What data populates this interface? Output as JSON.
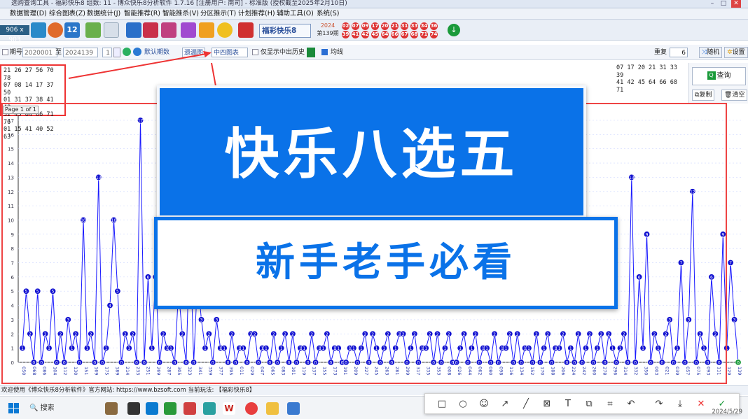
{
  "window": {
    "title": "选购查询工具 - 福彩快乐8 组数: 11 - 博众快乐8分析软件 1.7.16 [注册用户: 南司] - 标准版 (授权截至2025年2月10日)"
  },
  "menu": [
    "数据管理(D)",
    "综合图表(Z)",
    "数据统计(J)",
    "智能推荐(R)",
    "智能推杀(V)",
    "分区推示(T)",
    "计划推荐(H)",
    "辅助工具(O)",
    "系统(S)"
  ],
  "toolbar": {
    "resolution": "906 x 903",
    "lottery": "福彩快乐8",
    "issue_year": "2024",
    "issue_no": "第139期",
    "draw_top": [
      "02",
      "07",
      "09",
      "17",
      "20",
      "21",
      "31",
      "33",
      "34",
      "36"
    ],
    "draw_bottom": [
      "39",
      "41",
      "42",
      "45",
      "64",
      "66",
      "67",
      "68",
      "71",
      "74"
    ]
  },
  "filter": {
    "issue_label": "期号",
    "from": "2020001",
    "to_label": "至",
    "to": "2024139",
    "step": "1",
    "default_issue": "默认期数",
    "trend_btn": "遗漏图",
    "chart_type": "中四图表",
    "only_hist_label": "仅显示中出历史",
    "avg_label": "均线",
    "repeat_label": "重复",
    "repeat_value": "6",
    "random_btn": "随机",
    "settings_btn": "设置"
  },
  "left_numbers": [
    "21 26 27 56 70 78",
    "07 08 14 17 37 50",
    "01 31 37 38 41 48",
    "32 45 64 66 71 76",
    "01 15 41 40 52 63"
  ],
  "pager": "Page 1 of 1",
  "right_numbers": [
    "07 17 20 21 31 33 39",
    "41 42 45 64 66 68 71"
  ],
  "right_panel": {
    "query": "查询",
    "copy": "复制",
    "clear": "清空"
  },
  "overlay": {
    "headline": "快乐八选五",
    "subline": "新手老手必看"
  },
  "chart_data": {
    "type": "line",
    "ylim": [
      0,
      17
    ],
    "yticks": [
      0,
      1,
      2,
      3,
      4,
      5,
      6,
      7,
      8,
      9,
      10,
      11,
      12,
      13,
      14,
      15,
      16,
      17
    ],
    "xlabel_samples": [
      "050",
      "068",
      "086",
      "104",
      "112",
      "130",
      "151",
      "169",
      "175",
      "189",
      "214",
      "233",
      "251",
      "269",
      "287",
      "305",
      "323",
      "341",
      "359",
      "377",
      "395",
      "011",
      "029",
      "047",
      "065",
      "083",
      "101",
      "119",
      "137",
      "155",
      "173",
      "191",
      "209",
      "227",
      "245",
      "263",
      "281",
      "299",
      "317",
      "335",
      "353",
      "008",
      "026",
      "044",
      "062",
      "080",
      "098",
      "116",
      "134",
      "152",
      "170",
      "188",
      "206",
      "224",
      "242",
      "260",
      "278",
      "296",
      "314",
      "332",
      "350",
      "003",
      "021",
      "039",
      "057",
      "075",
      "093",
      "111",
      "129",
      "139"
    ],
    "values": [
      1,
      5,
      2,
      0,
      5,
      0,
      2,
      1,
      5,
      0,
      2,
      0,
      3,
      1,
      2,
      0,
      10,
      1,
      2,
      0,
      13,
      0,
      1,
      4,
      10,
      5,
      0,
      2,
      1,
      2,
      0,
      17,
      0,
      6,
      1,
      6,
      0,
      2,
      1,
      1,
      0,
      5,
      2,
      0,
      9,
      0,
      6,
      3,
      1,
      2,
      0,
      3,
      1,
      1,
      0,
      2,
      0,
      1,
      1,
      0,
      2,
      2,
      0,
      1,
      1,
      0,
      2,
      0,
      1,
      2,
      0,
      2,
      0,
      1,
      1,
      0,
      2,
      0,
      1,
      1,
      2,
      0,
      1,
      1,
      0,
      0,
      1,
      1,
      0,
      1,
      2,
      0,
      2,
      1,
      0,
      1,
      2,
      0,
      1,
      2,
      2,
      0,
      1,
      2,
      0,
      1,
      1,
      2,
      0,
      2,
      0,
      1,
      2,
      0,
      0,
      1,
      2,
      0,
      1,
      2,
      0,
      1,
      1,
      0,
      2,
      0,
      1,
      1,
      2,
      0,
      2,
      0,
      1,
      1,
      0,
      2,
      0,
      1,
      2,
      0,
      1,
      1,
      2,
      0,
      1,
      0,
      2,
      0,
      1,
      2,
      0,
      1,
      2,
      0,
      2,
      1,
      0,
      1,
      2,
      0,
      13,
      0,
      6,
      1,
      9,
      0,
      2,
      1,
      0,
      2,
      3,
      0,
      1,
      7,
      0,
      3,
      12,
      0,
      2,
      1,
      0,
      6,
      2,
      0,
      9,
      1,
      7,
      3,
      0
    ]
  },
  "status": "欢迎使用《博众快乐8分析软件》官方网站: https://www.bzsoft.com 当前玩法: 【福彩快乐8】",
  "taskbar": {
    "search": "搜索",
    "date": "2024/5/29"
  },
  "colors": {
    "overlay_blue": "#0a72e8",
    "chart_line": "#1a1aff",
    "highlight_red": "#e44"
  }
}
